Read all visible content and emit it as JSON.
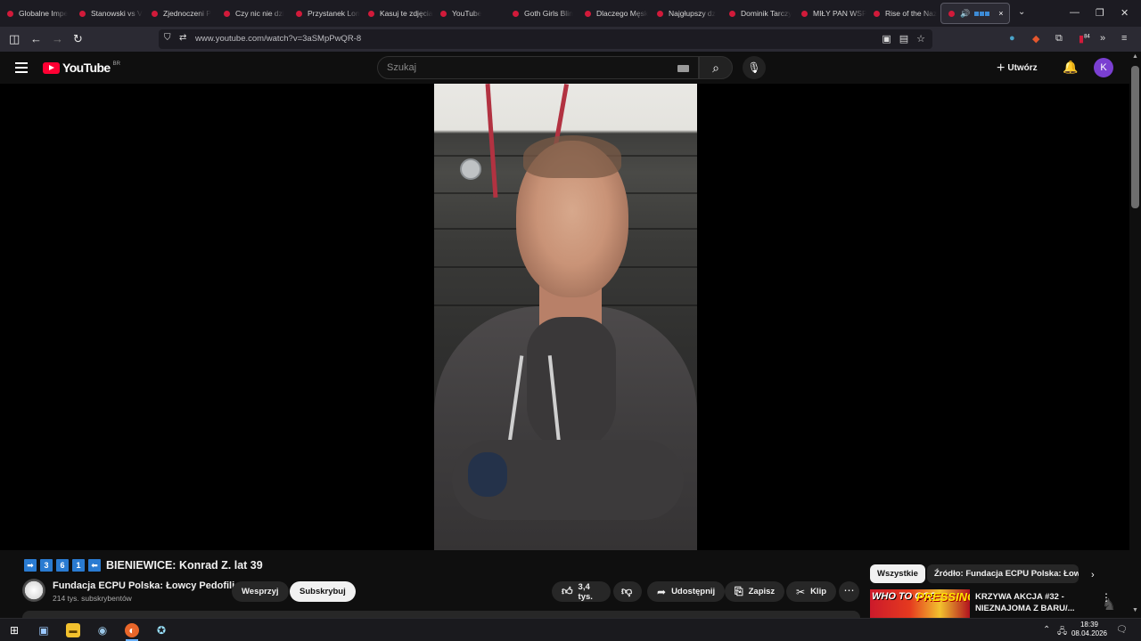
{
  "browser": {
    "tabs": [
      {
        "title": "Globalne Impe"
      },
      {
        "title": "Stanowski vs V"
      },
      {
        "title": "Zjednoczeni P"
      },
      {
        "title": "Czy nic nie dzi"
      },
      {
        "title": "Przystanek Lon"
      },
      {
        "title": "Kasuj te zdjęcia"
      },
      {
        "title": "YouTube"
      },
      {
        "title": "Goth Girls Blin"
      },
      {
        "title": "Dlaczego Męsk"
      },
      {
        "title": "Najgłupszy dz"
      },
      {
        "title": "Dominik Tarczy"
      },
      {
        "title": "MIŁY PAN WSP"
      },
      {
        "title": "Rise of the Naz"
      }
    ],
    "active_tab": {
      "audio_icon": "speaker-icon",
      "close": "×"
    },
    "url": "www.youtube.com/watch?v=3aSMpPwQR-8",
    "extension_badge": "84",
    "accent": "#d11a3a"
  },
  "youtube": {
    "logo_text": "YouTube",
    "country_code": "BR",
    "search_placeholder": "Szukaj",
    "create_label": "Utwórz",
    "avatar_letter": "K"
  },
  "video": {
    "title_badges": [
      "➡",
      "3",
      "6",
      "1",
      "⬅"
    ],
    "title": "BIENIEWICE: Konrad Z. lat 39",
    "channel_name": "Fundacja ECPU Polska: Łowcy Pedofili",
    "channel_subs": "214 tys. subskrybentów",
    "support_label": "Wesprzyj",
    "subscribe_label": "Subskrybuj",
    "likes": "3,4 tys.",
    "share_label": "Udostępnij",
    "save_label": "Zapisz",
    "clip_label": "Klip"
  },
  "sidebar": {
    "chip_all": "Wszystkie",
    "chip_source": "Źródło: Fundacja ECPU Polska: Łowcy",
    "recommended": {
      "thumb_text_1": "WHO TO GO?",
      "thumb_text_2": "PRESSING!",
      "title": "KRZYWA AKCJA #32 - NIEZNAJOMA Z BARU/..."
    }
  },
  "taskbar": {
    "time": "18:39",
    "date": "08.04.2026"
  }
}
